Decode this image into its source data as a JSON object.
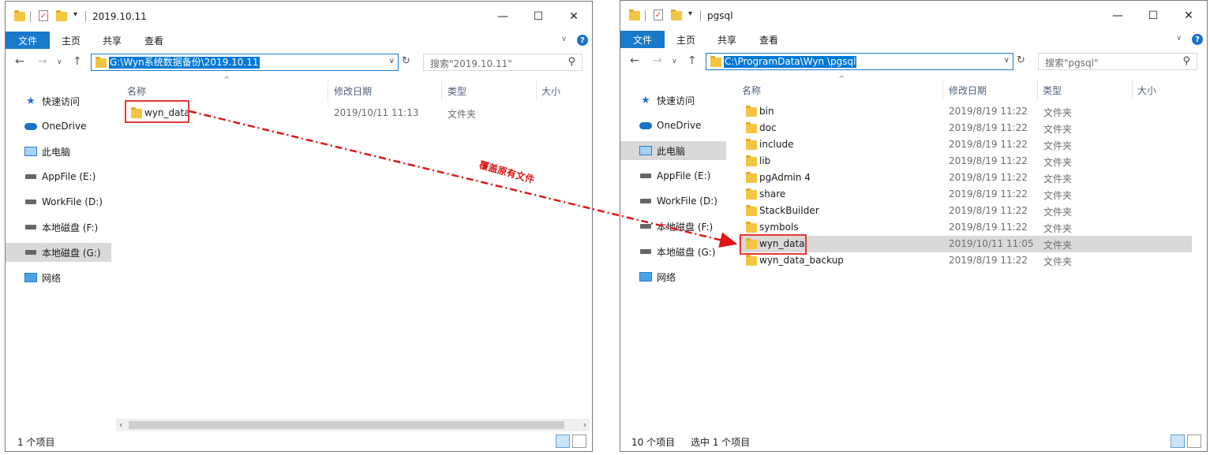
{
  "left": {
    "title": "2019.10.11",
    "ribbon": {
      "file": "文件",
      "home": "主页",
      "share": "共享",
      "view": "查看"
    },
    "address": "G:\\Wyn系统数据备份\\2019.10.11",
    "search_placeholder": "搜索\"2019.10.11\"",
    "columns": {
      "name": "名称",
      "modified": "修改日期",
      "type": "类型",
      "size": "大小"
    },
    "nav": [
      "快速访问",
      "OneDrive",
      "此电脑",
      "AppFile (E:)",
      "WorkFile (D:)",
      "本地磁盘 (F:)",
      "本地磁盘 (G:)",
      "网络"
    ],
    "rows": [
      {
        "name": "wyn_data",
        "modified": "2019/10/11 11:13",
        "type": "文件夹"
      }
    ],
    "status": "1 个项目"
  },
  "right": {
    "title": "pgsql",
    "ribbon": {
      "file": "文件",
      "home": "主页",
      "share": "共享",
      "view": "查看"
    },
    "address": "C:\\ProgramData\\Wyn \\pgsql",
    "search_placeholder": "搜索\"pgsql\"",
    "columns": {
      "name": "名称",
      "modified": "修改日期",
      "type": "类型",
      "size": "大小"
    },
    "nav": [
      "快速访问",
      "OneDrive",
      "此电脑",
      "AppFile (E:)",
      "WorkFile (D:)",
      "本地磁盘 (F:)",
      "本地磁盘 (G:)",
      "网络"
    ],
    "rows": [
      {
        "name": "bin",
        "modified": "2019/8/19 11:22",
        "type": "文件夹"
      },
      {
        "name": "doc",
        "modified": "2019/8/19 11:22",
        "type": "文件夹"
      },
      {
        "name": "include",
        "modified": "2019/8/19 11:22",
        "type": "文件夹"
      },
      {
        "name": "lib",
        "modified": "2019/8/19 11:22",
        "type": "文件夹"
      },
      {
        "name": "pgAdmin 4",
        "modified": "2019/8/19 11:22",
        "type": "文件夹"
      },
      {
        "name": "share",
        "modified": "2019/8/19 11:22",
        "type": "文件夹"
      },
      {
        "name": "StackBuilder",
        "modified": "2019/8/19 11:22",
        "type": "文件夹"
      },
      {
        "name": "symbols",
        "modified": "2019/8/19 11:22",
        "type": "文件夹"
      },
      {
        "name": "wyn_data",
        "modified": "2019/10/11 11:05",
        "type": "文件夹"
      },
      {
        "name": "wyn_data_backup",
        "modified": "2019/8/19 11:22",
        "type": "文件夹"
      }
    ],
    "status": "10 个项目",
    "status_selected": "选中 1 个项目"
  },
  "annotation": "覆盖原有文件",
  "colors": {
    "accent": "#1979ca",
    "highlight": "#e53935",
    "arrow": "#e01616",
    "selection": "#d9d9d9"
  }
}
